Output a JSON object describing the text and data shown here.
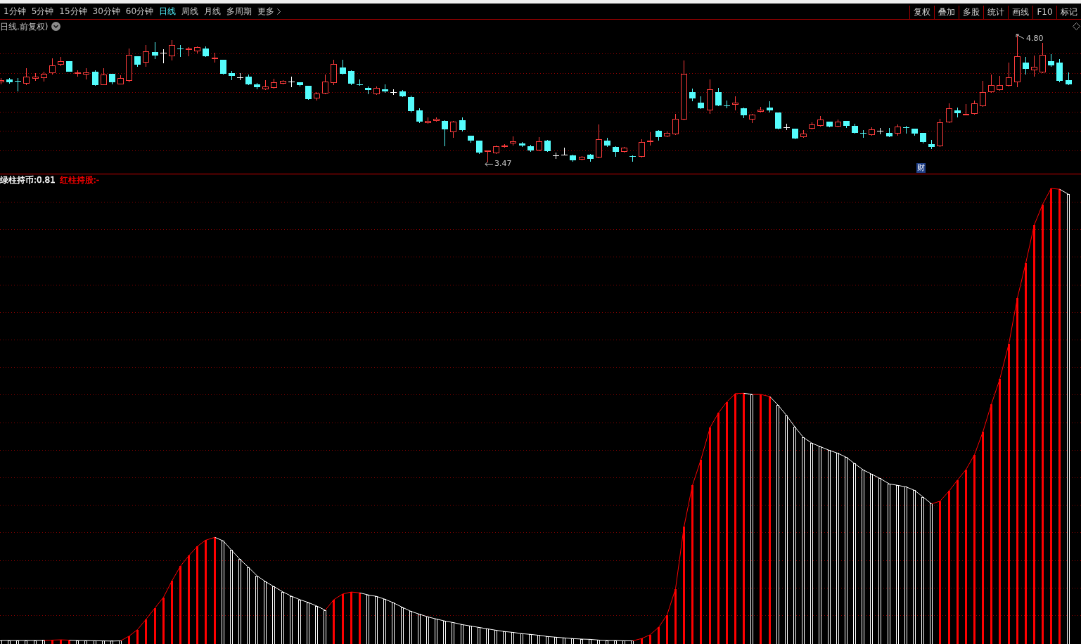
{
  "toolbar": {
    "periods": [
      {
        "label": "1分钟",
        "selected": false
      },
      {
        "label": "5分钟",
        "selected": false
      },
      {
        "label": "15分钟",
        "selected": false
      },
      {
        "label": "30分钟",
        "selected": false
      },
      {
        "label": "60分钟",
        "selected": false
      },
      {
        "label": "日线",
        "selected": true
      },
      {
        "label": "周线",
        "selected": false
      },
      {
        "label": "月线",
        "selected": false
      },
      {
        "label": "多周期",
        "selected": false
      }
    ],
    "more": "更多",
    "tools": [
      "复权",
      "叠加",
      "多股",
      "统计",
      "画线",
      "F10",
      "标记"
    ]
  },
  "price_panel": {
    "title": "日线.前复权)",
    "low_label": "3.47",
    "high_label": "4.80",
    "event_badge": "财"
  },
  "indicator_panel": {
    "legend": [
      {
        "label": "绿柱持币:0.81",
        "color": "#ffffff"
      },
      {
        "label": "红柱持股:-",
        "color": "#ff0000"
      }
    ]
  }
}
